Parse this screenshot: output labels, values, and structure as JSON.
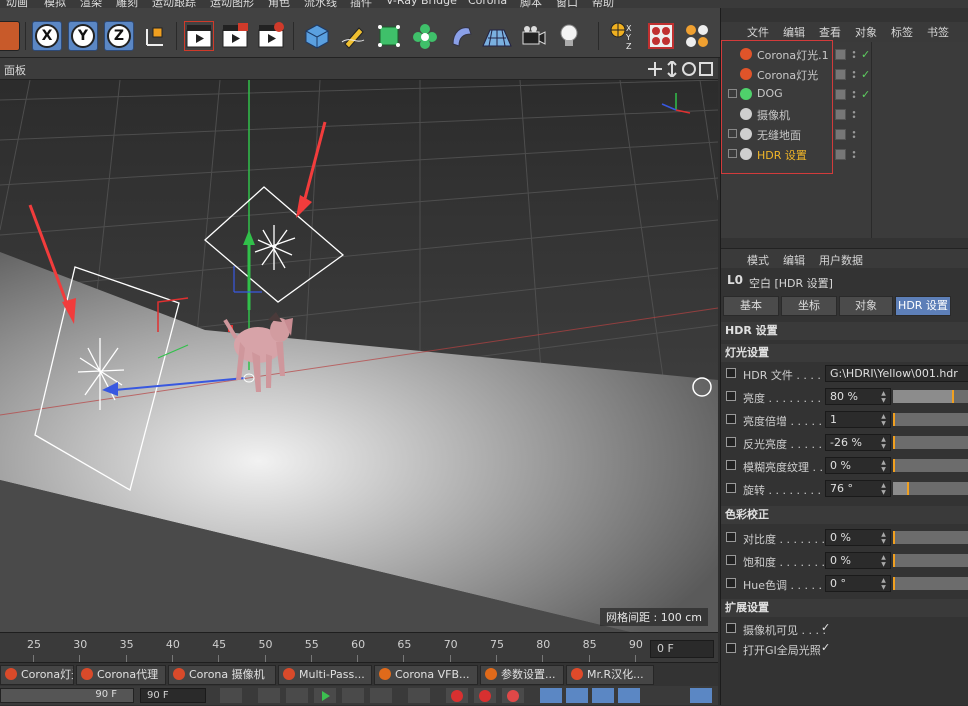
{
  "menubar": {
    "items": [
      "动画",
      "模拟",
      "渲染",
      "雕刻",
      "运动跟踪",
      "运动图形",
      "角色",
      "流水线",
      "插件",
      "V-Ray Bridge",
      "Corona",
      "脚本",
      "窗口",
      "帮助"
    ]
  },
  "toolbar": {
    "axis_x": "X",
    "axis_y": "Y",
    "axis_z": "Z",
    "coord_xyz": "XYZ"
  },
  "viewport": {
    "panel_label": "面板",
    "grid_spacing": "网格间距 : 100 cm"
  },
  "timeline": {
    "ticks": [
      "25",
      "30",
      "35",
      "40",
      "45",
      "50",
      "55",
      "60",
      "65",
      "70",
      "75",
      "80",
      "85",
      "90"
    ],
    "frame": "0 F"
  },
  "bottom_tabs": [
    {
      "label": "Corona灯光",
      "color": "#d94a2a"
    },
    {
      "label": "Corona代理",
      "color": "#d94a2a"
    },
    {
      "label": "Corona 摄像机",
      "color": "#d94a2a"
    },
    {
      "label": "Multi-Pass...",
      "color": "#d94a2a"
    },
    {
      "label": "Corona VFB...",
      "color": "#e06a1a"
    },
    {
      "label": "参数设置...",
      "color": "#e06a1a"
    },
    {
      "label": "Mr.R汉化...",
      "color": "#e04a2a"
    }
  ],
  "playbar": {
    "start_frame": "90 F",
    "end_frame": "90 F"
  },
  "object_manager": {
    "menu": [
      "文件",
      "编辑",
      "查看",
      "对象",
      "标签",
      "书签"
    ],
    "objects": [
      {
        "name": "Corona灯光.1",
        "icon_color": "#e0542a",
        "expandable": false,
        "highlight": false
      },
      {
        "name": "Corona灯光",
        "icon_color": "#e0542a",
        "expandable": false,
        "highlight": false
      },
      {
        "name": "DOG",
        "icon_color": "#4fd16b",
        "expandable": true,
        "highlight": false
      },
      {
        "name": "摄像机",
        "icon_color": "#cfcfcf",
        "expandable": false,
        "highlight": false
      },
      {
        "name": "无缝地面",
        "icon_color": "#cfcfcf",
        "expandable": true,
        "highlight": false
      },
      {
        "name": "HDR 设置",
        "icon_color": "#cfcfcf",
        "expandable": true,
        "highlight": true
      }
    ]
  },
  "attribute_manager": {
    "menu": [
      "模式",
      "编辑",
      "用户数据"
    ],
    "title": "空白 [HDR 设置]",
    "tabs": [
      "基本",
      "坐标",
      "对象",
      "HDR 设置"
    ],
    "active_tab": "HDR 设置",
    "section_main": "HDR 设置",
    "section_light": "灯光设置",
    "light_params": [
      {
        "label": "HDR 文件 . . . . . .",
        "value": "G:\\HDRI\\Yellow\\001.hdr",
        "wide": true
      },
      {
        "label": "亮度 . . . . . . . . . .",
        "value": "80 %",
        "level": 0.8
      },
      {
        "label": "亮度倍增 . . . . . . .",
        "value": "1",
        "level": 0.0
      },
      {
        "label": "反光亮度 . . . . . . .",
        "value": "-26 %",
        "level": 0.0
      },
      {
        "label": "模糊亮度纹理 . . .",
        "value": "0 %",
        "level": 0.0
      },
      {
        "label": "旋转 . . . . . . . . . .",
        "value": "76 °",
        "level": 0.21
      }
    ],
    "section_color": "色彩校正",
    "color_params": [
      {
        "label": "对比度 . . . . . . . .",
        "value": "0 %",
        "level": 0.0
      },
      {
        "label": "饱和度 . . . . . . . .",
        "value": "0 %",
        "level": 0.0
      },
      {
        "label": "Hue色调 . . . . . . .",
        "value": "0 °",
        "level": 0.0
      }
    ],
    "section_ext": "扩展设置",
    "ext_params": [
      {
        "label": "摄像机可见 . . . .",
        "check": "✓"
      },
      {
        "label": "打开GI全局光照",
        "check": "✓"
      }
    ]
  }
}
